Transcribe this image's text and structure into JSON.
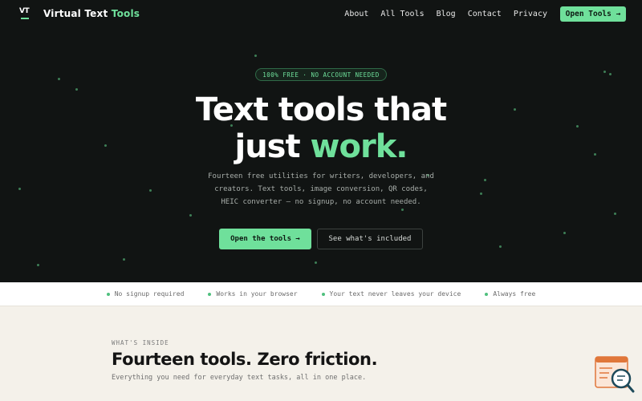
{
  "header": {
    "logo_mark": "VT",
    "logo_text": "Virtual Text",
    "logo_accent": "Tools",
    "nav": [
      "About",
      "All Tools",
      "Blog",
      "Contact",
      "Privacy"
    ],
    "cta": "Open Tools →"
  },
  "hero": {
    "badge": "100% FREE · NO ACCOUNT NEEDED",
    "headline_line1": "Text tools that",
    "headline_line2_plain": "just",
    "headline_line2_accent": "work.",
    "subtext": "Fourteen free utilities for writers, developers, and creators. Text tools, image conversion, QR codes, HEIC converter — no signup, no account needed.",
    "primary_button": "Open the tools →",
    "secondary_button": "See what's included"
  },
  "features_strip": [
    "No signup required",
    "Works in your browser",
    "Your text never leaves your device",
    "Always free"
  ],
  "inside": {
    "kicker": "WHAT'S INSIDE",
    "title": "Fourteen tools. Zero friction.",
    "subtitle": "Everything you need for everyday text tasks, all in one place."
  },
  "colors": {
    "accent": "#6fe09b",
    "hero_bg": "#111413",
    "page_bg": "#f4f1ea"
  },
  "icons": {
    "chat_widget": "document-search-icon"
  }
}
